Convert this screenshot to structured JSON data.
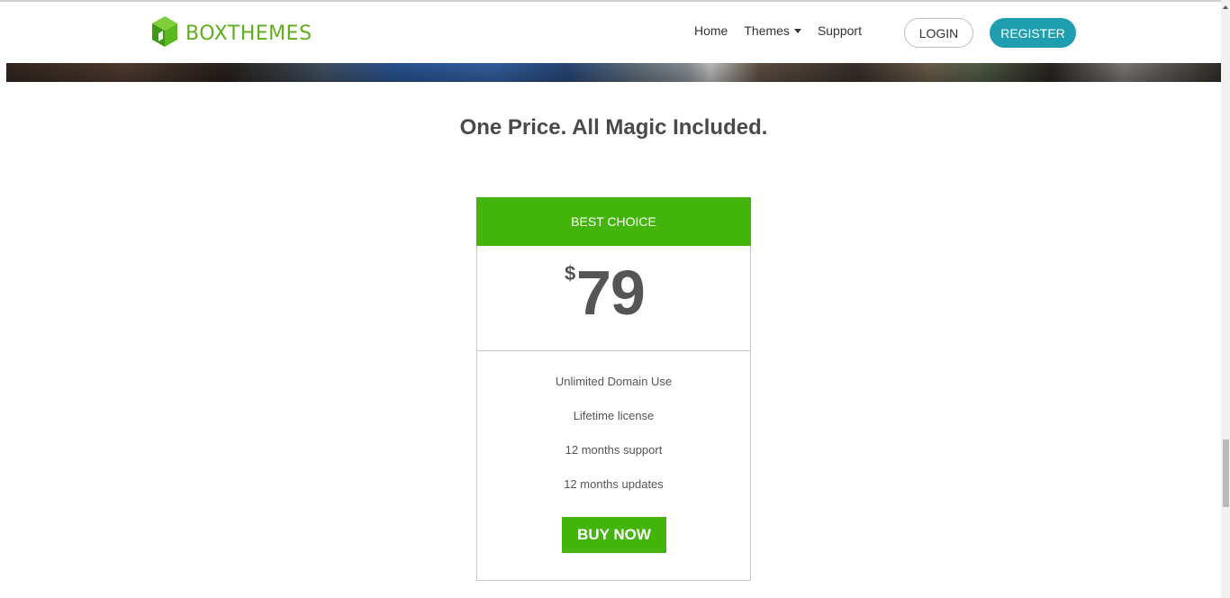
{
  "header": {
    "logo_text": "BOXTHEMES",
    "logo_icon": "box-logo-icon",
    "nav": [
      {
        "label": "Home"
      },
      {
        "label": "Themes",
        "has_dropdown": true
      },
      {
        "label": "Support"
      }
    ],
    "login_label": "LOGIN",
    "register_label": "REGISTER"
  },
  "section": {
    "title": "One Price. All Magic Included."
  },
  "pricing": {
    "badge": "BEST CHOICE",
    "currency": "$",
    "amount": "79",
    "features": [
      "Unlimited Domain Use",
      "Lifetime license",
      "12 months support",
      "12 months updates"
    ],
    "buy_label": "BUY NOW"
  },
  "colors": {
    "brand_green": "#43b50a",
    "register_teal": "#1f9eb0",
    "text_dark": "#4a4a4a"
  }
}
